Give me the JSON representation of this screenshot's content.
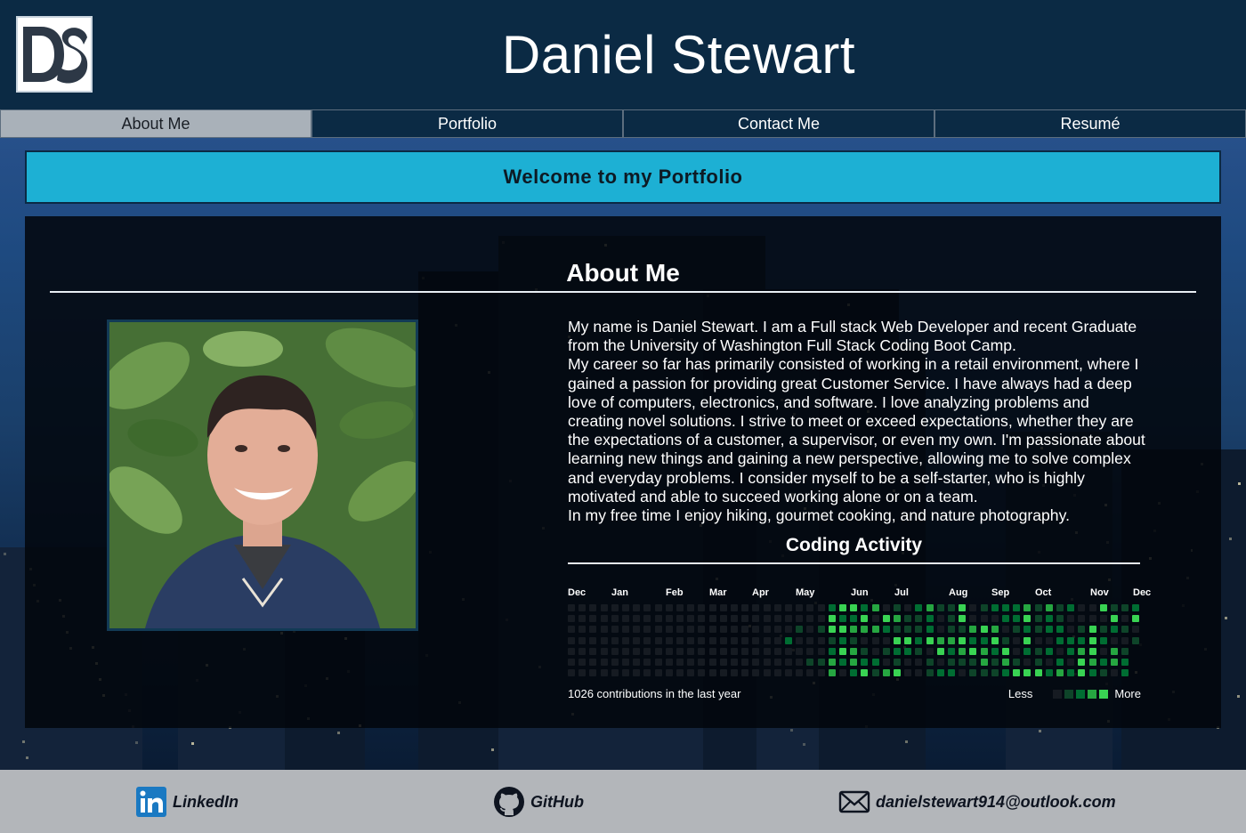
{
  "header": {
    "title": "Daniel Stewart",
    "logo_icon": "ds-monogram-logo"
  },
  "nav": {
    "tabs": [
      {
        "label": "About Me",
        "active": true
      },
      {
        "label": "Portfolio",
        "active": false
      },
      {
        "label": "Contact Me",
        "active": false
      },
      {
        "label": "Resumé",
        "active": false
      }
    ]
  },
  "welcome": "Welcome to my Portfolio",
  "about": {
    "heading": "About Me",
    "paragraphs": [
      "My name is Daniel Stewart. I am a Full stack Web Developer and recent Graduate from the University of Washington Full Stack Coding Boot Camp.",
      "My career so far has primarily consisted of working in a retail environment, where I gained a passion for providing great Customer Service. I have always had a deep love of computers, electronics, and software. I love analyzing problems and creating novel solutions. I strive to meet or exceed expectations, whether they are the expectations of a customer, a supervisor, or even my own. I'm passionate about learning new things and gaining a new perspective, allowing me to solve complex and everyday problems. I consider myself to be a self-starter, who is highly motivated and able to succeed working alone or on a team.",
      "In my free time I enjoy hiking, gourmet cooking, and nature photography."
    ]
  },
  "coding": {
    "heading": "Coding Activity",
    "months": [
      "Dec",
      "Jan",
      "Feb",
      "Mar",
      "Apr",
      "May",
      "Jun",
      "Jul",
      "Aug",
      "Sep",
      "Oct",
      "Nov",
      "Dec"
    ],
    "contributions": "1026 contributions in the last year",
    "legend_less": "Less",
    "legend_more": "More",
    "colors": [
      "#161b22",
      "#0e4429",
      "#006d32",
      "#26a641",
      "#39d353"
    ]
  },
  "footer": {
    "linkedin": "LinkedIn",
    "github": "GitHub",
    "email": "danielstewart914@outlook.com",
    "linkedin_icon": "linkedin-icon",
    "github_icon": "github-icon",
    "email_icon": "envelope-icon"
  }
}
